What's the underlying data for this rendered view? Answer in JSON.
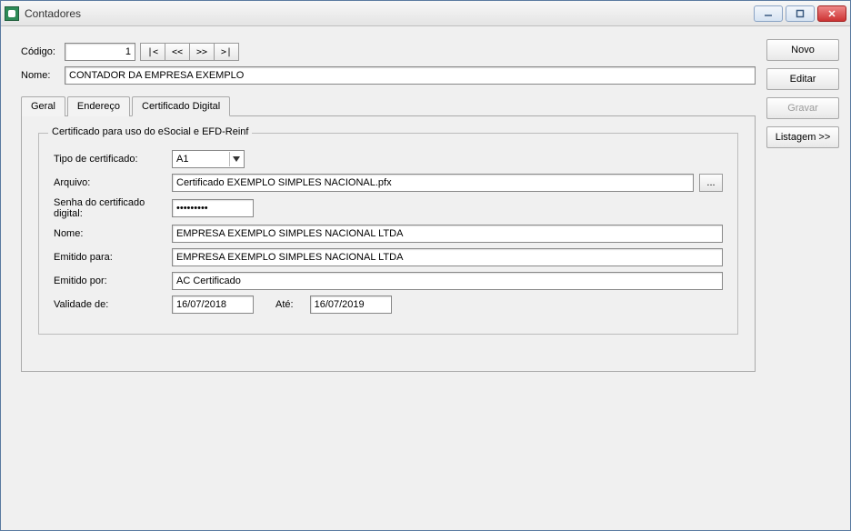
{
  "window": {
    "title": "Contadores"
  },
  "header": {
    "codigo_label": "Código:",
    "codigo_value": "1",
    "nome_label": "Nome:",
    "nome_value": "CONTADOR DA EMPRESA EXEMPLO",
    "nav": {
      "first": "|<",
      "prev": "<<",
      "next": ">>",
      "last": ">|"
    }
  },
  "tabs": {
    "geral": "Geral",
    "endereco": "Endereço",
    "cert": "Certificado Digital"
  },
  "group": {
    "legend": "Certificado para uso do eSocial e EFD-Reinf",
    "tipo_label": "Tipo de certificado:",
    "tipo_value": "A1",
    "arquivo_label": "Arquivo:",
    "arquivo_value": "Certificado EXEMPLO SIMPLES NACIONAL.pfx",
    "browse_label": "...",
    "senha_label": "Senha do certificado digital:",
    "senha_value": "xxxxxxxxx",
    "nome_label": "Nome:",
    "nome_value": "EMPRESA EXEMPLO SIMPLES NACIONAL LTDA",
    "emitido_para_label": "Emitido para:",
    "emitido_para_value": "EMPRESA EXEMPLO SIMPLES NACIONAL LTDA",
    "emitido_por_label": "Emitido por:",
    "emitido_por_value": "AC Certificado",
    "validade_label": "Validade de:",
    "validade_de": "16/07/2018",
    "ate_label": "Até:",
    "validade_ate": "16/07/2019"
  },
  "side": {
    "novo": "Novo",
    "editar": "Editar",
    "gravar": "Gravar",
    "listagem": "Listagem >>"
  }
}
